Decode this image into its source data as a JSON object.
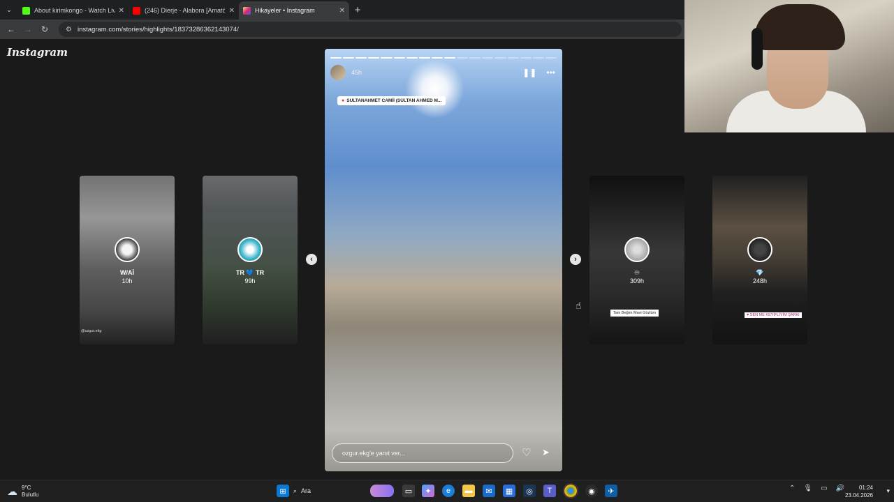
{
  "browser": {
    "tabs": [
      {
        "title": "About kirimkongo - Watch Live",
        "favicon_color": "#53fc18"
      },
      {
        "title": "(246) Dierje - Alabora [Amatör",
        "favicon_color": "#ff0000"
      },
      {
        "title": "Hikayeler • Instagram",
        "favicon_color": "#d62976"
      }
    ],
    "url": "instagram.com/stories/highlights/18373286362143074/"
  },
  "instagram": {
    "logo": "Instagram",
    "story": {
      "time": "45h",
      "location": "SULTANAHMET CAMİİ (SULTAN AHMED M...",
      "reply_placeholder": "ozgur.ekg'e yanıt ver...",
      "progress_total": 18,
      "progress_done": 10
    },
    "side_stories": [
      {
        "name": "W/Aİ",
        "time": "10h",
        "caption": "@ozgur.ekg"
      },
      {
        "name": "TR 💙 TR",
        "time": "99h",
        "caption": ""
      },
      {
        "name": "♾",
        "time": "309h",
        "caption": "Tam Beğim Mavi Gözlüm"
      },
      {
        "name": "💎",
        "time": "248h",
        "caption": "♥ SEN ME KEYİFLİYİM ŞARKI"
      }
    ]
  },
  "taskbar": {
    "weather_temp": "9°C",
    "weather_desc": "Bulutlu",
    "search_label": "Ara",
    "time": "01:24",
    "date": "23.04.2026"
  }
}
